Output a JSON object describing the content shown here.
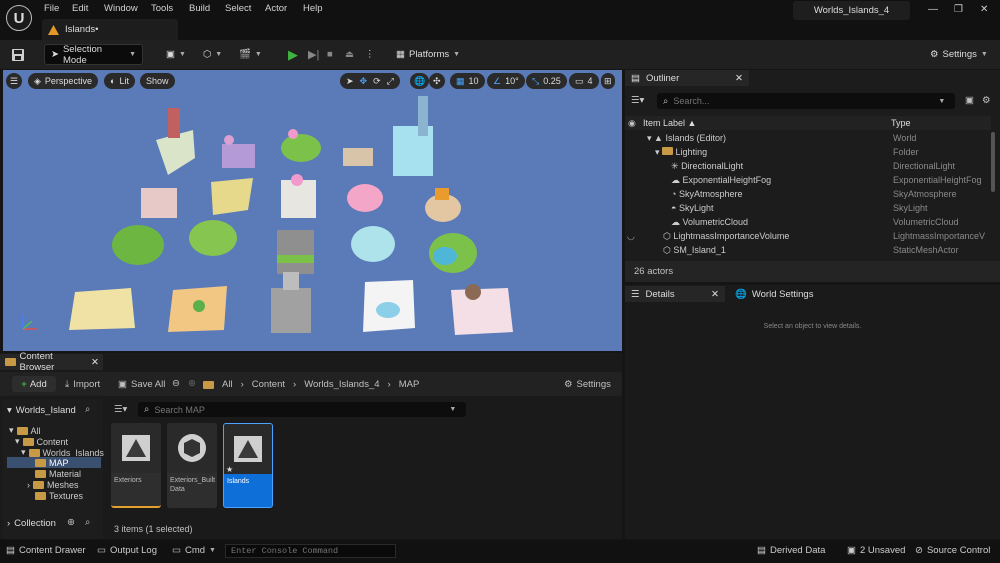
{
  "menu": [
    "File",
    "Edit",
    "Window",
    "Tools",
    "Build",
    "Select",
    "Actor",
    "Help"
  ],
  "level_tab": "Islands•",
  "window_title": "Worlds_Islands_4",
  "toolbar": {
    "selection_mode": "Selection Mode",
    "platforms": "Platforms",
    "settings": "Settings"
  },
  "viewport": {
    "perspective": "Perspective",
    "lit": "Lit",
    "show": "Show",
    "grid_snap": "10",
    "rot_snap": "10°",
    "scale_snap": "0.25",
    "cam_speed": "4"
  },
  "outliner": {
    "tab": "Outliner",
    "search_placeholder": "Search...",
    "col_label": "Item Label ▲",
    "col_type": "Type",
    "actor_count": "26 actors",
    "rows": [
      {
        "label": "Islands (Editor)",
        "type": "World"
      },
      {
        "label": "Lighting",
        "type": "Folder"
      },
      {
        "label": "DirectionalLight",
        "type": "DirectionalLight"
      },
      {
        "label": "ExponentialHeightFog",
        "type": "ExponentialHeightFog"
      },
      {
        "label": "SkyAtmosphere",
        "type": "SkyAtmosphere"
      },
      {
        "label": "SkyLight",
        "type": "SkyLight"
      },
      {
        "label": "VolumetricCloud",
        "type": "VolumetricCloud"
      },
      {
        "label": "LightmassImportanceVolume",
        "type": "LightmassImportanceV"
      },
      {
        "label": "SM_Island_1",
        "type": "StaticMeshActor"
      }
    ]
  },
  "details": {
    "tab": "Details",
    "world_settings": "World Settings",
    "empty": "Select an object to view details."
  },
  "content_browser": {
    "tab": "Content Browser",
    "add": "Add",
    "import": "Import",
    "save_all": "Save All",
    "settings": "Settings",
    "breadcrumb": [
      "All",
      "Content",
      "Worlds_Islands_4",
      "MAP"
    ],
    "source_title": "Worlds_Island",
    "tree": [
      "All",
      "Content",
      "Worlds_Islands",
      "MAP",
      "Material",
      "Meshes",
      "Textures"
    ],
    "search_placeholder": "Search MAP",
    "collection": "Collection",
    "assets": [
      {
        "name": "Exteriors"
      },
      {
        "name": "Exteriors_Built Data"
      },
      {
        "name": "Islands"
      }
    ],
    "status": "3 items (1 selected)"
  },
  "statusbar": {
    "content_drawer": "Content Drawer",
    "output_log": "Output Log",
    "cmd": "Cmd",
    "console_placeholder": "Enter Console Command",
    "derived_data": "Derived Data",
    "unsaved": "2 Unsaved",
    "source_control": "Source Control"
  },
  "colors": {
    "accent_blue": "#0f6fd8",
    "sky": "#5878b7",
    "play_green": "#3fb23f"
  }
}
